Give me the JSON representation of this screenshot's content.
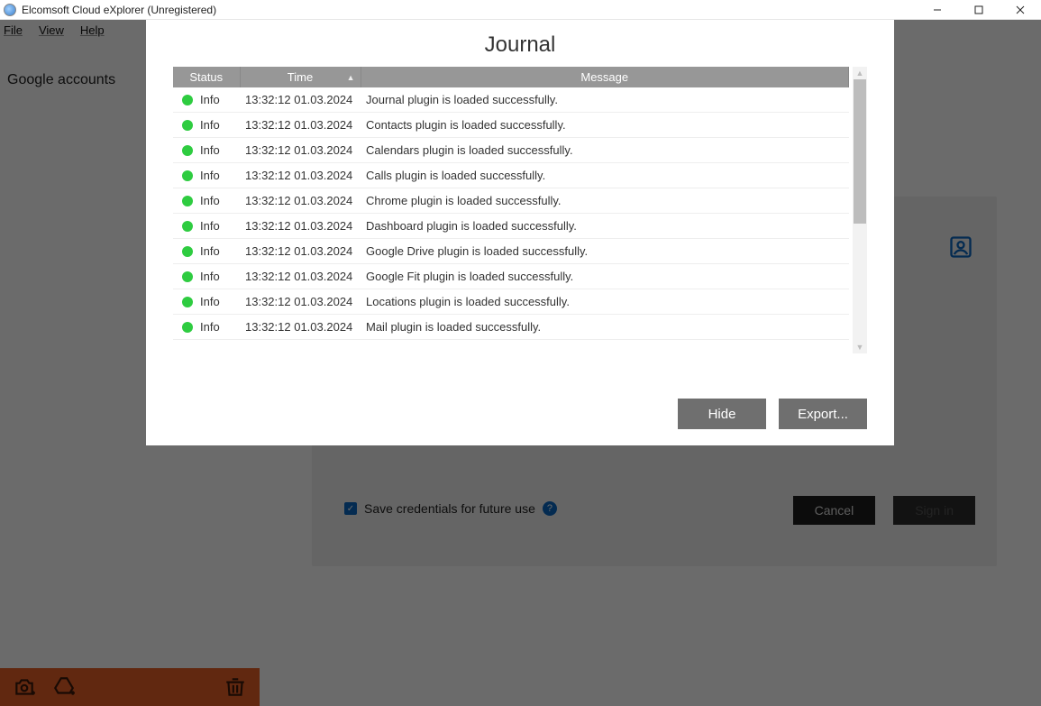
{
  "window": {
    "title": "Elcomsoft Cloud eXplorer (Unregistered)"
  },
  "menubar": {
    "file": "File",
    "view": "View",
    "help": "Help"
  },
  "sidebar": {
    "tab": "Google accounts"
  },
  "signin": {
    "save_credentials_label": "Save credentials for future use",
    "cancel_label": "Cancel",
    "signin_label": "Sign in"
  },
  "journal": {
    "title": "Journal",
    "columns": {
      "status": "Status",
      "time": "Time",
      "message": "Message"
    },
    "status_label": "Info",
    "rows": [
      {
        "time": "13:32:12 01.03.2024",
        "message": "Journal plugin is loaded successfully."
      },
      {
        "time": "13:32:12 01.03.2024",
        "message": "Contacts plugin is loaded successfully."
      },
      {
        "time": "13:32:12 01.03.2024",
        "message": "Calendars plugin is loaded successfully."
      },
      {
        "time": "13:32:12 01.03.2024",
        "message": "Calls plugin is loaded successfully."
      },
      {
        "time": "13:32:12 01.03.2024",
        "message": "Chrome plugin is loaded successfully."
      },
      {
        "time": "13:32:12 01.03.2024",
        "message": "Dashboard plugin is loaded successfully."
      },
      {
        "time": "13:32:12 01.03.2024",
        "message": "Google Drive plugin is loaded successfully."
      },
      {
        "time": "13:32:12 01.03.2024",
        "message": "Google Fit plugin is loaded successfully."
      },
      {
        "time": "13:32:12 01.03.2024",
        "message": "Locations plugin is loaded successfully."
      },
      {
        "time": "13:32:12 01.03.2024",
        "message": "Mail plugin is loaded successfully."
      }
    ],
    "buttons": {
      "hide": "Hide",
      "export": "Export..."
    }
  }
}
